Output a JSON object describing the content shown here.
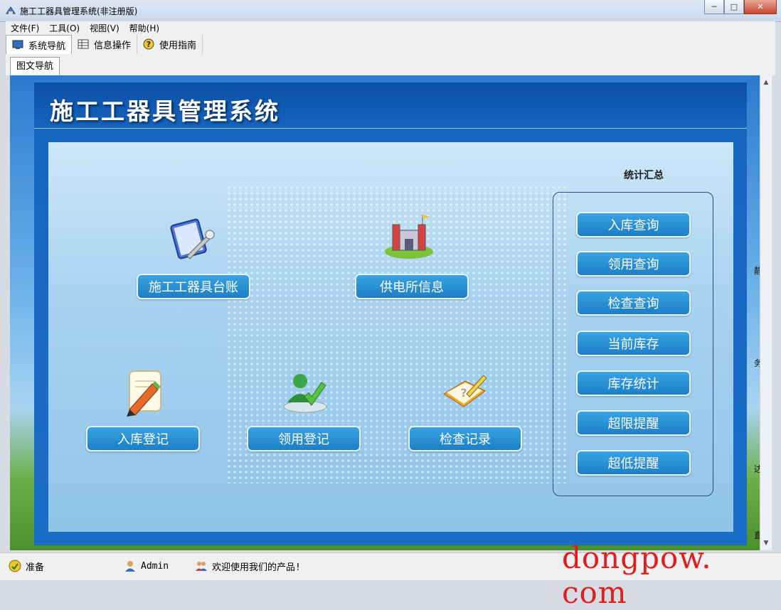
{
  "window": {
    "title": "施工工器具管理系统(非注册版)"
  },
  "menu": {
    "items": [
      "文件(F)",
      "工具(O)",
      "视图(V)",
      "帮助(H)"
    ]
  },
  "toolbar": {
    "tabs": [
      "系统导航",
      "信息操作",
      "使用指南"
    ]
  },
  "doc_tab": {
    "label": "图文导航"
  },
  "panel": {
    "title": "施工工器具管理系统",
    "buttons": {
      "ledger": "施工工器具台账",
      "station_info": "供电所信息",
      "stock_in": "入库登记",
      "borrow": "领用登记",
      "inspection": "检查记录"
    }
  },
  "stats": {
    "title": "统计汇总",
    "buttons": [
      "入库查询",
      "领用查询",
      "检查查询",
      "当前库存",
      "库存统计",
      "超限提醒",
      "超低提醒"
    ]
  },
  "side_glyphs": [
    "静",
    "务",
    "达",
    "直"
  ],
  "status": {
    "ready": "准备",
    "user": "Admin",
    "welcome": "欢迎使用我们的产品!"
  },
  "watermark": "dongpow. com",
  "colors": {
    "button": "#1d7ec6",
    "panel": "#1565c0",
    "watermark": "#e11d1d"
  }
}
